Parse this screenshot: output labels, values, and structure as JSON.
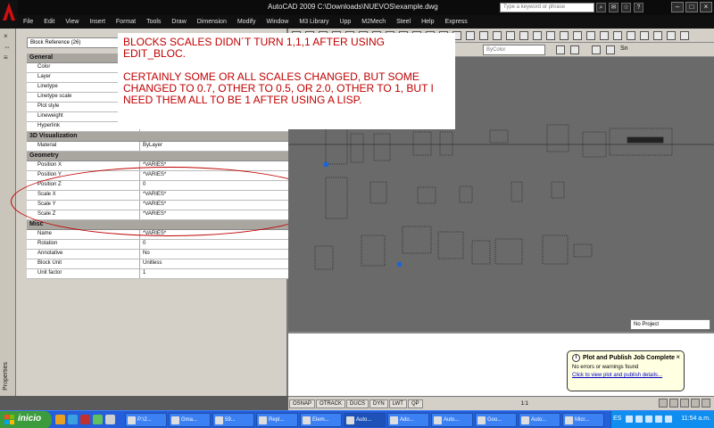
{
  "window": {
    "title": "AutoCAD 2009  C:\\Downloads\\NUEVOS\\example.dwg",
    "search_placeholder": "Type a keyword or phrase"
  },
  "menu": [
    "File",
    "Edit",
    "View",
    "Insert",
    "Format",
    "Tools",
    "Draw",
    "Dimension",
    "Modify",
    "Window",
    "M3 Library",
    "Upp",
    "M2Mech",
    "Steel",
    "Help",
    "Express"
  ],
  "properties": {
    "palette_label": "Properties",
    "selection": "Block Reference (26)",
    "categories": [
      {
        "name": "General",
        "rows": [
          {
            "key": "Color",
            "value": ""
          },
          {
            "key": "Layer",
            "value": ""
          },
          {
            "key": "Linetype",
            "value": ""
          },
          {
            "key": "Linetype scale",
            "value": ""
          },
          {
            "key": "Plot style",
            "value": ""
          },
          {
            "key": "Lineweight",
            "value": ""
          },
          {
            "key": "Hyperlink",
            "value": ""
          }
        ]
      },
      {
        "name": "3D Visualization",
        "rows": [
          {
            "key": "Material",
            "value": "ByLayer"
          }
        ]
      },
      {
        "name": "Geometry",
        "rows": [
          {
            "key": "Position X",
            "value": "*VARIES*"
          },
          {
            "key": "Position Y",
            "value": "*VARIES*"
          },
          {
            "key": "Position Z",
            "value": "0"
          },
          {
            "key": "Scale X",
            "value": "*VARIES*"
          },
          {
            "key": "Scale Y",
            "value": "*VARIES*"
          },
          {
            "key": "Scale Z",
            "value": "*VARIES*"
          }
        ]
      },
      {
        "name": "Misc",
        "rows": [
          {
            "key": "Name",
            "value": "*VARIES*"
          },
          {
            "key": "Rotation",
            "value": "0"
          },
          {
            "key": "Annotative",
            "value": "No"
          },
          {
            "key": "Block Unit",
            "value": "Unitless"
          },
          {
            "key": "Unit factor",
            "value": "1"
          }
        ]
      }
    ]
  },
  "annotation": {
    "line1": "BLOCKS SCALES DIDN´T TURN 1,1,1 AFTER USING EDIT_BLOC.",
    "line2": "CERTAINLY SOME OR ALL SCALES CHANGED, BUT SOME CHANGED TO 0.7, OTHER TO 0.5, OR 2.0, OTHER TO 1, BUT I NEED THEM ALL TO BE 1 AFTER USING A LISP."
  },
  "toolbar": {
    "combo_bylayer": "ByColor",
    "sn_label": "Sn"
  },
  "project": "No Project",
  "statusbar": {
    "buttons": [
      "OSNAP",
      "OTRACK",
      "DUCS",
      "DYN",
      "LWT",
      "QP"
    ],
    "scale": "1:1"
  },
  "balloon": {
    "title": "Plot and Publish Job Complete",
    "message": "No errors or warnings found",
    "link": "Click to view plot and publish details..."
  },
  "taskbar": {
    "start": "inicio",
    "tasks": [
      "P:\\2...",
      "Gma...",
      "59...",
      "Repl...",
      "Elem...",
      "Auto...",
      "Ado...",
      "Auto...",
      "Goo...",
      "Auto...",
      "Micr..."
    ],
    "language": "ES",
    "clock": "11:54 a.m."
  },
  "colors": {
    "annotation_text": "#c00000",
    "taskbar": "#245edb",
    "start_button": "#3c9b3c"
  }
}
